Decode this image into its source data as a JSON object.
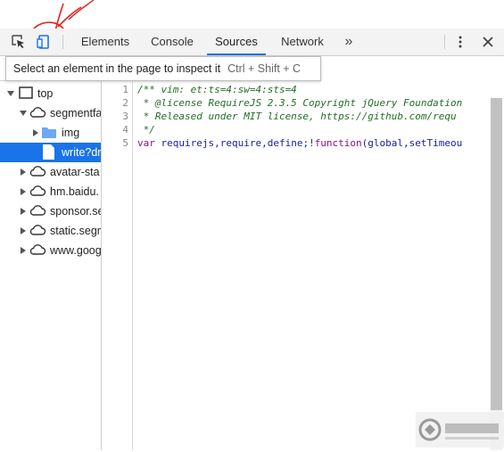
{
  "toolbar": {
    "inspect_icon": "inspect-element-icon",
    "device_icon": "device-toolbar-icon",
    "tabs": [
      {
        "label": "Elements"
      },
      {
        "label": "Console"
      },
      {
        "label": "Sources"
      },
      {
        "label": "Network"
      }
    ],
    "more_tabs": "»",
    "menu_icon": "vertical-dots-icon",
    "close_icon": "close-icon",
    "accent": "#1a73e8"
  },
  "tooltip": {
    "text": "Select an element in the page to inspect it",
    "shortcut": "Ctrl + Shift + C"
  },
  "tree": {
    "items": [
      {
        "label": "top"
      },
      {
        "label": "segmentfa"
      },
      {
        "label": "img"
      },
      {
        "label": "write?dr"
      },
      {
        "label": "avatar-sta"
      },
      {
        "label": "hm.baidu."
      },
      {
        "label": "sponsor.se"
      },
      {
        "label": "static.segm"
      },
      {
        "label": "www.goog"
      }
    ]
  },
  "editor": {
    "line_numbers": [
      "1",
      "2",
      "3",
      "4",
      "5"
    ],
    "lines": [
      "/** vim: et:ts=4:sw=4:sts=4",
      " * @license RequireJS 2.3.5 Copyright jQuery Foundation",
      " * Released under MIT license, https://github.com/requ",
      " */",
      {
        "kw": "var",
        "rest": " requirejs,require,define;",
        "op": "!",
        "kw2": "function",
        "rest2": "(global,setTimeou"
      }
    ]
  },
  "watermark": {
    "logo": "watermark-logo-icon"
  }
}
